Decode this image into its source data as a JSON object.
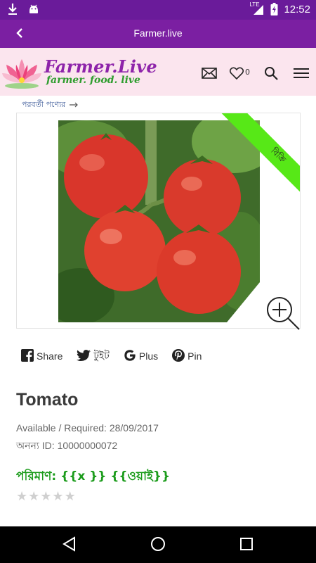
{
  "status_bar": {
    "time": "12:52",
    "network": "LTE",
    "icons": [
      "download-icon",
      "android-icon",
      "signal-icon",
      "battery-icon"
    ]
  },
  "app_bar": {
    "title": "Farmer.live",
    "back_icon": "back-arrow-icon"
  },
  "site_header": {
    "brand_title": "Farmer.Live",
    "brand_tagline": "farmer. food. live",
    "wishlist_count": "0",
    "icons": [
      "mail-icon",
      "heart-icon",
      "search-icon",
      "menu-icon"
    ]
  },
  "product": {
    "next_link": "পরবর্তী পণ্যের",
    "ribbon": "বিক্রি",
    "title": "Tomato",
    "availability": "Available / Required: 28/09/2017",
    "unique_id": "অনন্য ID: 10000000072",
    "quantity": "পরিমাণ: {{x }} {{ওয়াই}}",
    "rating": 0
  },
  "share": {
    "items": [
      {
        "label": "Share",
        "icon": "facebook-icon"
      },
      {
        "label": "টুইট",
        "icon": "twitter-icon"
      },
      {
        "label": "Plus",
        "icon": "google-plus-icon"
      },
      {
        "label": "Pin",
        "icon": "pinterest-icon"
      }
    ]
  },
  "colors": {
    "status_bar": "#6a1b9a",
    "app_bar": "#7b1fa2",
    "header_bg": "#fbe5ee",
    "brand": "#8e24aa",
    "accent_green": "#1c9c1c",
    "ribbon": "#57e817"
  }
}
